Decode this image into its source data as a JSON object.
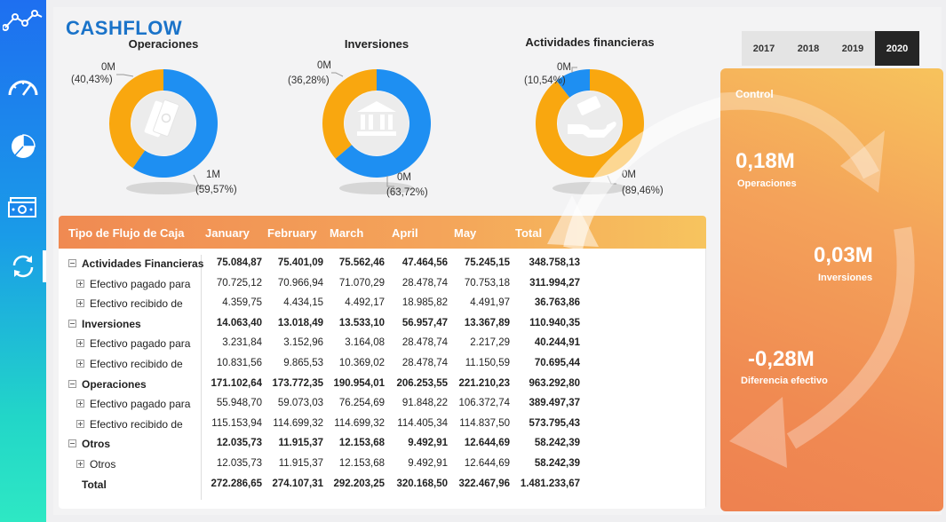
{
  "title": "CASHFLOW",
  "sidebar": {
    "items": [
      {
        "icon": "line-chart-icon"
      },
      {
        "icon": "speedometer-icon"
      },
      {
        "icon": "pie-chart-icon"
      },
      {
        "icon": "banknote-icon"
      },
      {
        "icon": "refresh-icon",
        "active": true
      }
    ]
  },
  "donuts": [
    {
      "title": "Operaciones",
      "icon": "banknotes-icon",
      "small": {
        "value": "0M",
        "pct": "(40,43%)",
        "fraction": 0.4043,
        "color": "#f9a70f"
      },
      "large": {
        "value": "1M",
        "pct": "(59,57%)",
        "fraction": 0.5957,
        "color": "#1e8ff2"
      }
    },
    {
      "title": "Inversiones",
      "icon": "bank-icon",
      "small": {
        "value": "0M",
        "pct": "(36,28%)",
        "fraction": 0.3628,
        "color": "#f9a70f"
      },
      "large": {
        "value": "0M",
        "pct": "(63,72%)",
        "fraction": 0.6372,
        "color": "#1e8ff2"
      }
    },
    {
      "title": "Actividades financieras",
      "icon": "money-hand-icon",
      "small": {
        "value": "0M",
        "pct": "(10,54%)",
        "fraction": 0.1054,
        "color": "#1e8ff2"
      },
      "large": {
        "value": "0M",
        "pct": "(89,46%)",
        "fraction": 0.8946,
        "color": "#f9a70f"
      }
    }
  ],
  "table": {
    "headers": [
      "Tipo de Flujo de Caja",
      "January",
      "February",
      "March",
      "April",
      "May",
      "Total"
    ],
    "rows": [
      {
        "label": "Actividades Financieras",
        "level": 0,
        "bold": true,
        "toggle": "minus",
        "values": [
          "75.084,87",
          "75.401,09",
          "75.562,46",
          "47.464,56",
          "75.245,15",
          "348.758,13"
        ]
      },
      {
        "label": "Efectivo pagado para",
        "level": 1,
        "bold": false,
        "toggle": "plus",
        "values": [
          "70.725,12",
          "70.966,94",
          "71.070,29",
          "28.478,74",
          "70.753,18",
          "311.994,27"
        ]
      },
      {
        "label": "Efectivo recibido de",
        "level": 1,
        "bold": false,
        "toggle": "plus",
        "values": [
          "4.359,75",
          "4.434,15",
          "4.492,17",
          "18.985,82",
          "4.491,97",
          "36.763,86"
        ]
      },
      {
        "label": "Inversiones",
        "level": 0,
        "bold": true,
        "toggle": "minus",
        "values": [
          "14.063,40",
          "13.018,49",
          "13.533,10",
          "56.957,47",
          "13.367,89",
          "110.940,35"
        ]
      },
      {
        "label": "Efectivo pagado para",
        "level": 1,
        "bold": false,
        "toggle": "plus",
        "values": [
          "3.231,84",
          "3.152,96",
          "3.164,08",
          "28.478,74",
          "2.217,29",
          "40.244,91"
        ]
      },
      {
        "label": "Efectivo recibido de",
        "level": 1,
        "bold": false,
        "toggle": "plus",
        "values": [
          "10.831,56",
          "9.865,53",
          "10.369,02",
          "28.478,74",
          "11.150,59",
          "70.695,44"
        ]
      },
      {
        "label": "Operaciones",
        "level": 0,
        "bold": true,
        "toggle": "minus",
        "values": [
          "171.102,64",
          "173.772,35",
          "190.954,01",
          "206.253,55",
          "221.210,23",
          "963.292,80"
        ]
      },
      {
        "label": "Efectivo pagado para",
        "level": 1,
        "bold": false,
        "toggle": "plus",
        "values": [
          "55.948,70",
          "59.073,03",
          "76.254,69",
          "91.848,22",
          "106.372,74",
          "389.497,37"
        ]
      },
      {
        "label": "Efectivo recibido de",
        "level": 1,
        "bold": false,
        "toggle": "plus",
        "values": [
          "115.153,94",
          "114.699,32",
          "114.699,32",
          "114.405,34",
          "114.837,50",
          "573.795,43"
        ]
      },
      {
        "label": "Otros",
        "level": 0,
        "bold": true,
        "toggle": "minus",
        "values": [
          "12.035,73",
          "11.915,37",
          "12.153,68",
          "9.492,91",
          "12.644,69",
          "58.242,39"
        ]
      },
      {
        "label": "Otros",
        "level": 1,
        "bold": false,
        "toggle": "plus",
        "values": [
          "12.035,73",
          "11.915,37",
          "12.153,68",
          "9.492,91",
          "12.644,69",
          "58.242,39"
        ]
      },
      {
        "label": "Total",
        "level": 0,
        "bold": true,
        "toggle": "none",
        "values": [
          "272.286,65",
          "274.107,31",
          "292.203,25",
          "320.168,50",
          "322.467,96",
          "1.481.233,67"
        ]
      }
    ]
  },
  "years": [
    {
      "label": "2017",
      "selected": false
    },
    {
      "label": "2018",
      "selected": false
    },
    {
      "label": "2019",
      "selected": false
    },
    {
      "label": "2020",
      "selected": true
    }
  ],
  "control": {
    "title": "Control",
    "kpis": [
      {
        "value": "0,18M",
        "label": "Operaciones"
      },
      {
        "value": "0,03M",
        "label": "Inversiones"
      },
      {
        "value": "-0,28M",
        "label": "Diferencia efectivo"
      }
    ]
  }
}
